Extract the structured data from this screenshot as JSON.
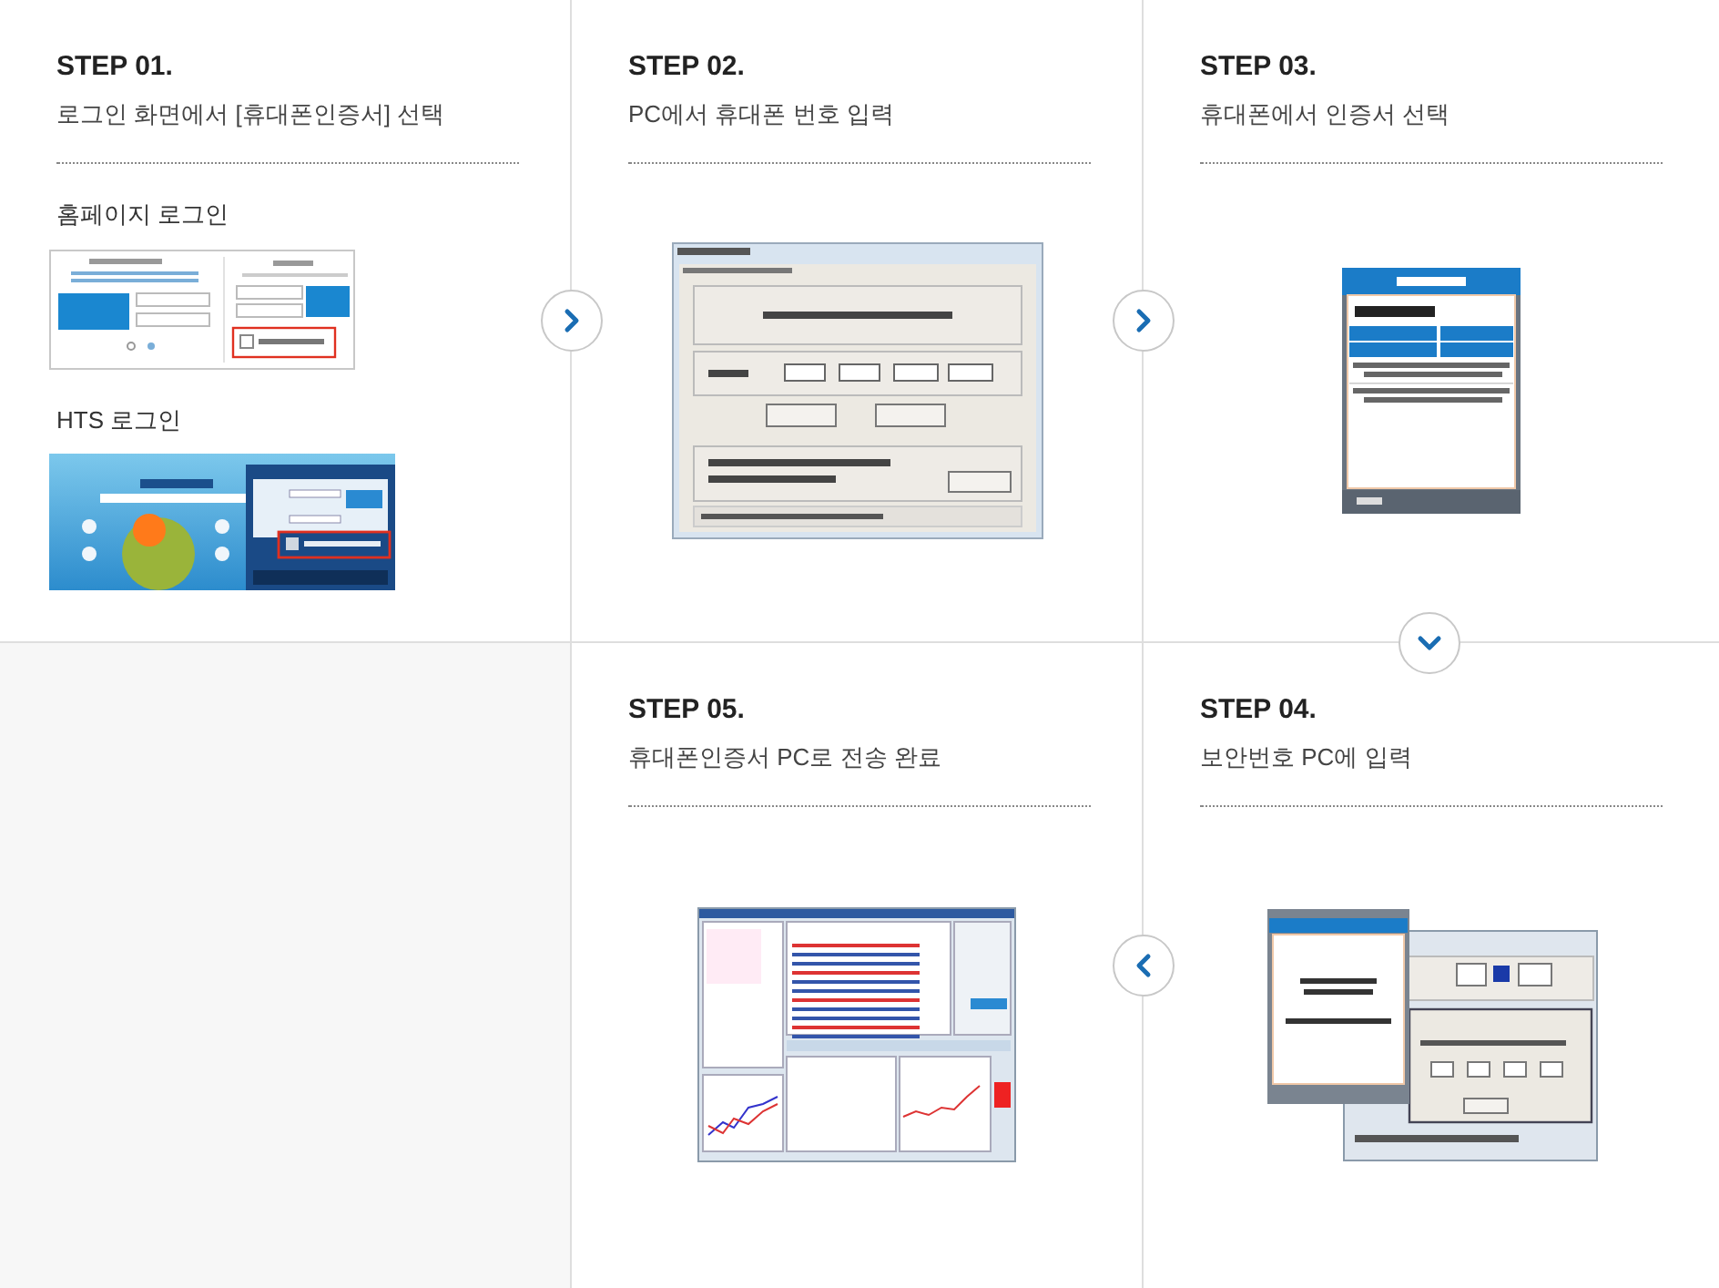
{
  "rows": [
    [
      {
        "kind": "step",
        "step": "STEP 01.",
        "title": "로그인 화면에서 [휴대폰인증서] 선택",
        "sections": [
          {
            "label": "홈페이지 로그인",
            "kind": "web-login"
          },
          {
            "label": "HTS 로그인",
            "kind": "hts-login"
          }
        ]
      },
      {
        "kind": "step",
        "step": "STEP 02.",
        "title": "PC에서 휴대폰 번호 입력",
        "sections": [
          {
            "kind": "pc-dialog"
          }
        ]
      },
      {
        "kind": "step",
        "step": "STEP 03.",
        "title": "휴대폰에서 인증서 선택",
        "sections": [
          {
            "kind": "phone-list"
          }
        ]
      }
    ],
    [
      {
        "kind": "empty"
      },
      {
        "kind": "step",
        "step": "STEP 05.",
        "title": "휴대폰인증서 PC로 전송 완료",
        "sections": [
          {
            "kind": "trading"
          }
        ]
      },
      {
        "kind": "step",
        "step": "STEP 04.",
        "title": "보안번호 PC에 입력",
        "sections": [
          {
            "kind": "security-code"
          }
        ]
      }
    ]
  ],
  "arrows": [
    {
      "kind": "right"
    },
    {
      "kind": "right"
    },
    {
      "kind": "down"
    },
    {
      "kind": "left"
    }
  ]
}
